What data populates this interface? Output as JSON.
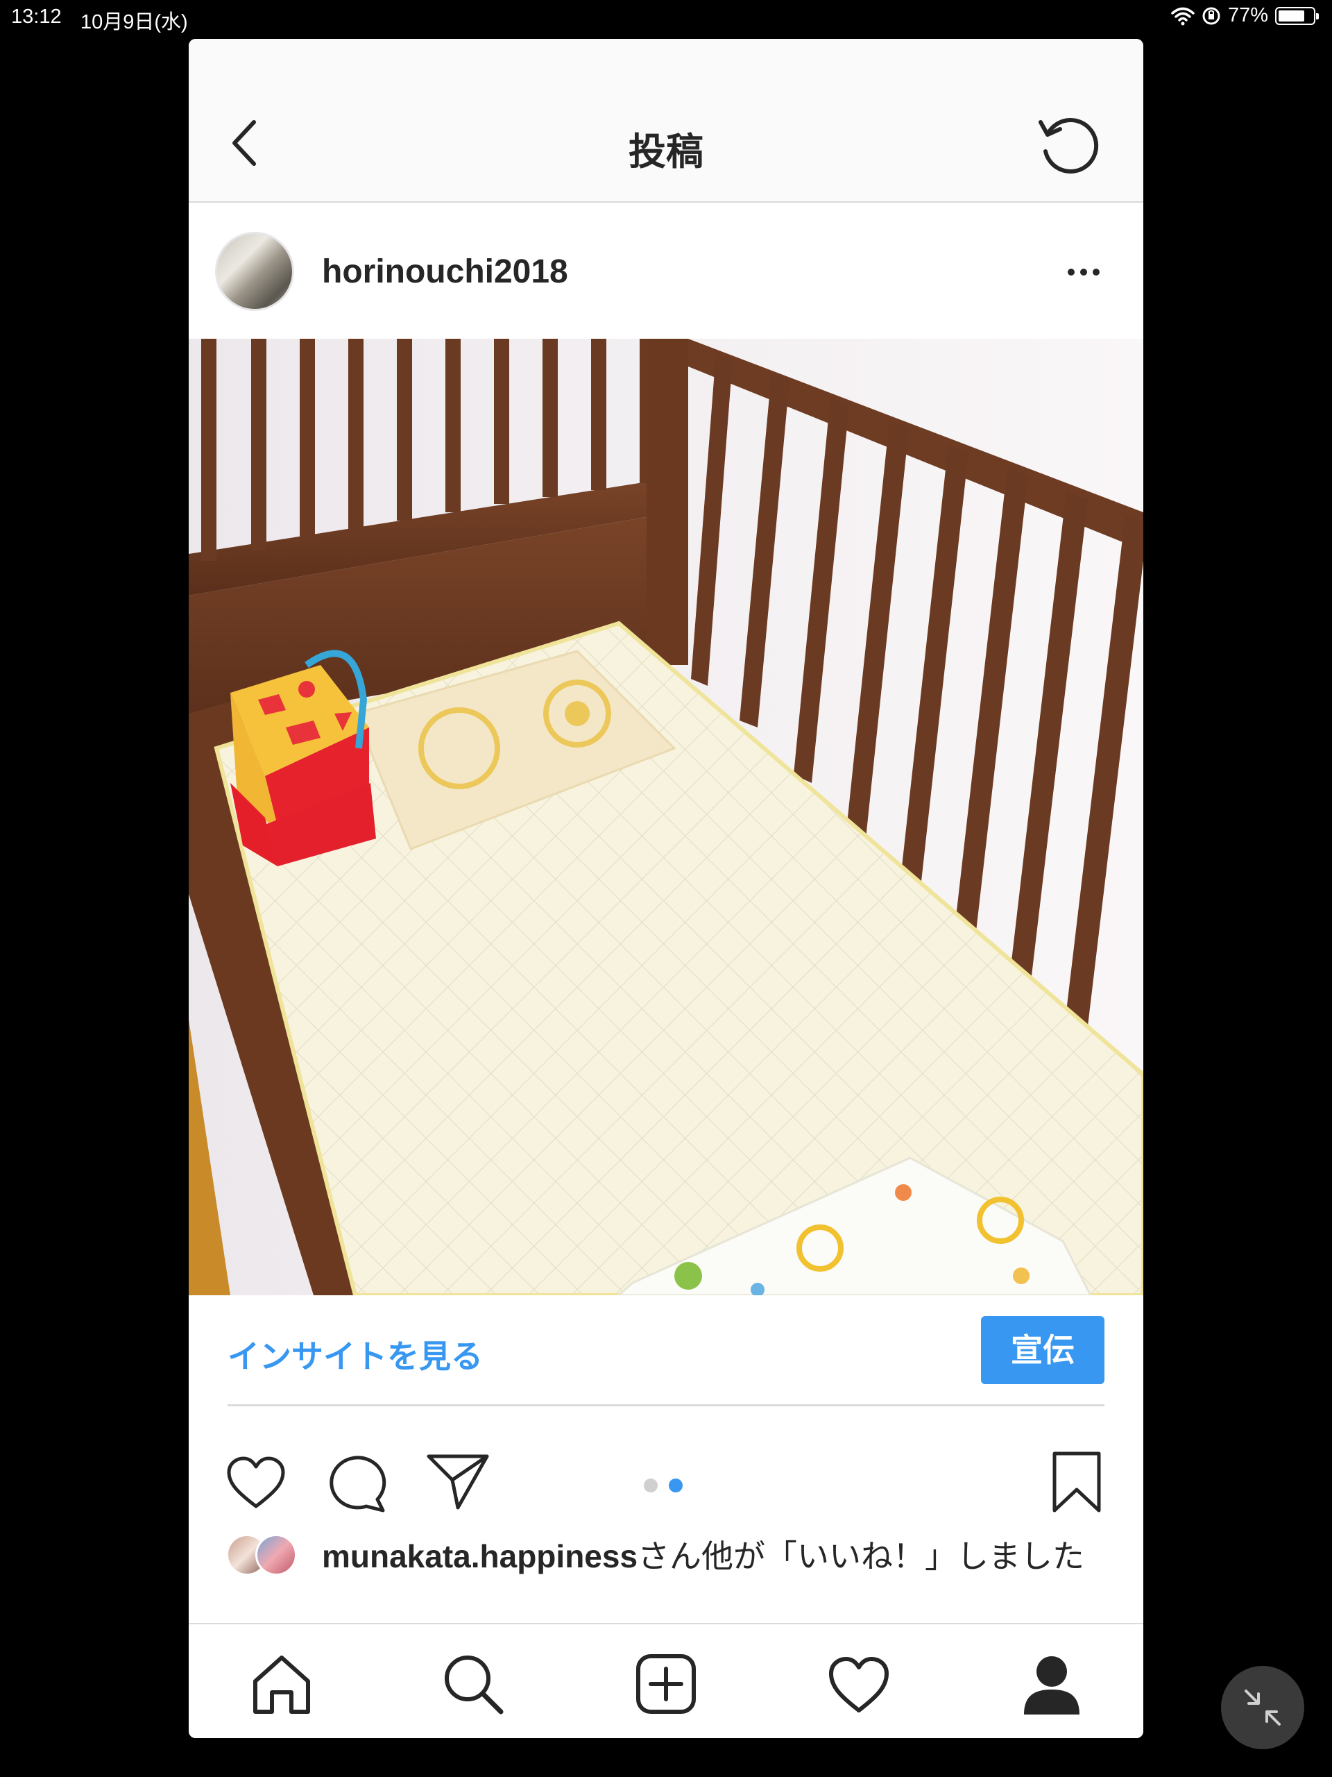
{
  "status_bar": {
    "time": "13:12",
    "date": "10月9日(水)",
    "battery": "77%",
    "battery_level": 0.77
  },
  "header": {
    "title": "投稿",
    "back_icon": "chevron-left-icon",
    "refresh_icon": "refresh-icon"
  },
  "post": {
    "username": "horinouchi2018",
    "more_icon": "ellipsis-icon",
    "insight_label": "インサイトを見る",
    "promote_label": "宣伝",
    "carousel": {
      "count": 2,
      "active": 2
    },
    "likes": {
      "user": "munakata.happiness",
      "suffix": "さん他が「いいね！」しました"
    }
  },
  "tabbar": {
    "items": [
      "home-icon",
      "search-icon",
      "add-post-icon",
      "activity-heart-icon",
      "profile-icon"
    ]
  },
  "colors": {
    "accent": "#3897f0",
    "text": "#262626",
    "crib_wood": "#6b3a22",
    "mattress": "#f6f2dc"
  }
}
